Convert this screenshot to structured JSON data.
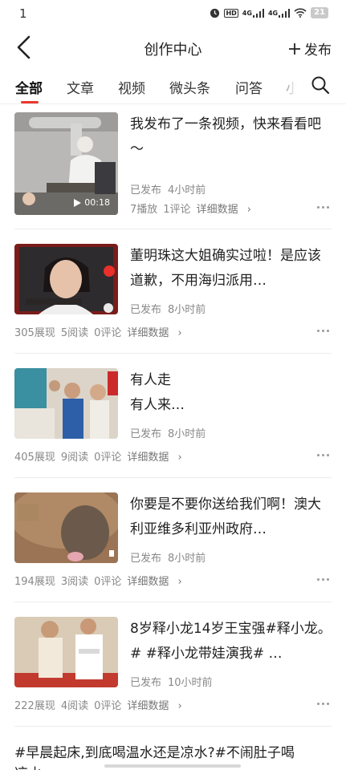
{
  "status_bar": {
    "time": "1",
    "icons": [
      "alarm-icon",
      "hd-icon",
      "signal-4g-icon",
      "signal-4g-icon",
      "wifi-icon",
      "battery-icon"
    ],
    "hd_label": "HD",
    "net1": "4G",
    "net2": "4G",
    "battery": "21"
  },
  "nav": {
    "title": "创作中心",
    "publish_label": "发布"
  },
  "tabs": [
    {
      "label": "全部",
      "active": true
    },
    {
      "label": "文章",
      "active": false
    },
    {
      "label": "视频",
      "active": false
    },
    {
      "label": "微头条",
      "active": false
    },
    {
      "label": "问答",
      "active": false
    },
    {
      "label": "小",
      "active": false
    }
  ],
  "items": [
    {
      "title": "我发布了一条视频，快来看看吧～",
      "status": "已发布",
      "time": "4小时前",
      "stats": [
        "7播放",
        "1评论"
      ],
      "detail": "详细数据",
      "duration": "00:18"
    },
    {
      "title": "董明珠这大姐确实过啦！是应该道歉，不用海归派用…",
      "status": "已发布",
      "time": "8小时前",
      "stats": [
        "305展现",
        "5阅读",
        "0评论"
      ],
      "detail": "详细数据"
    },
    {
      "title": "有人走 有人来…",
      "title_line1": "有人走",
      "title_line2": "有人来…",
      "status": "已发布",
      "time": "8小时前",
      "stats": [
        "405展现",
        "9阅读",
        "0评论"
      ],
      "detail": "详细数据"
    },
    {
      "title": "你要是不要你送给我们啊！澳大利亚维多利亚州政府…",
      "status": "已发布",
      "time": "8小时前",
      "stats": [
        "194展现",
        "3阅读",
        "0评论"
      ],
      "detail": "详细数据"
    },
    {
      "title": "8岁释小龙14岁王宝强#释小龙。# #释小龙带娃演我# …",
      "status": "已发布",
      "time": "10小时前",
      "stats": [
        "222展现",
        "4阅读",
        "0评论"
      ],
      "detail": "详细数据"
    }
  ],
  "last_item": {
    "title": "#早晨起床,到底喝温水还是凉水?#不闹肚子喝",
    "title_line2": "凉水"
  }
}
